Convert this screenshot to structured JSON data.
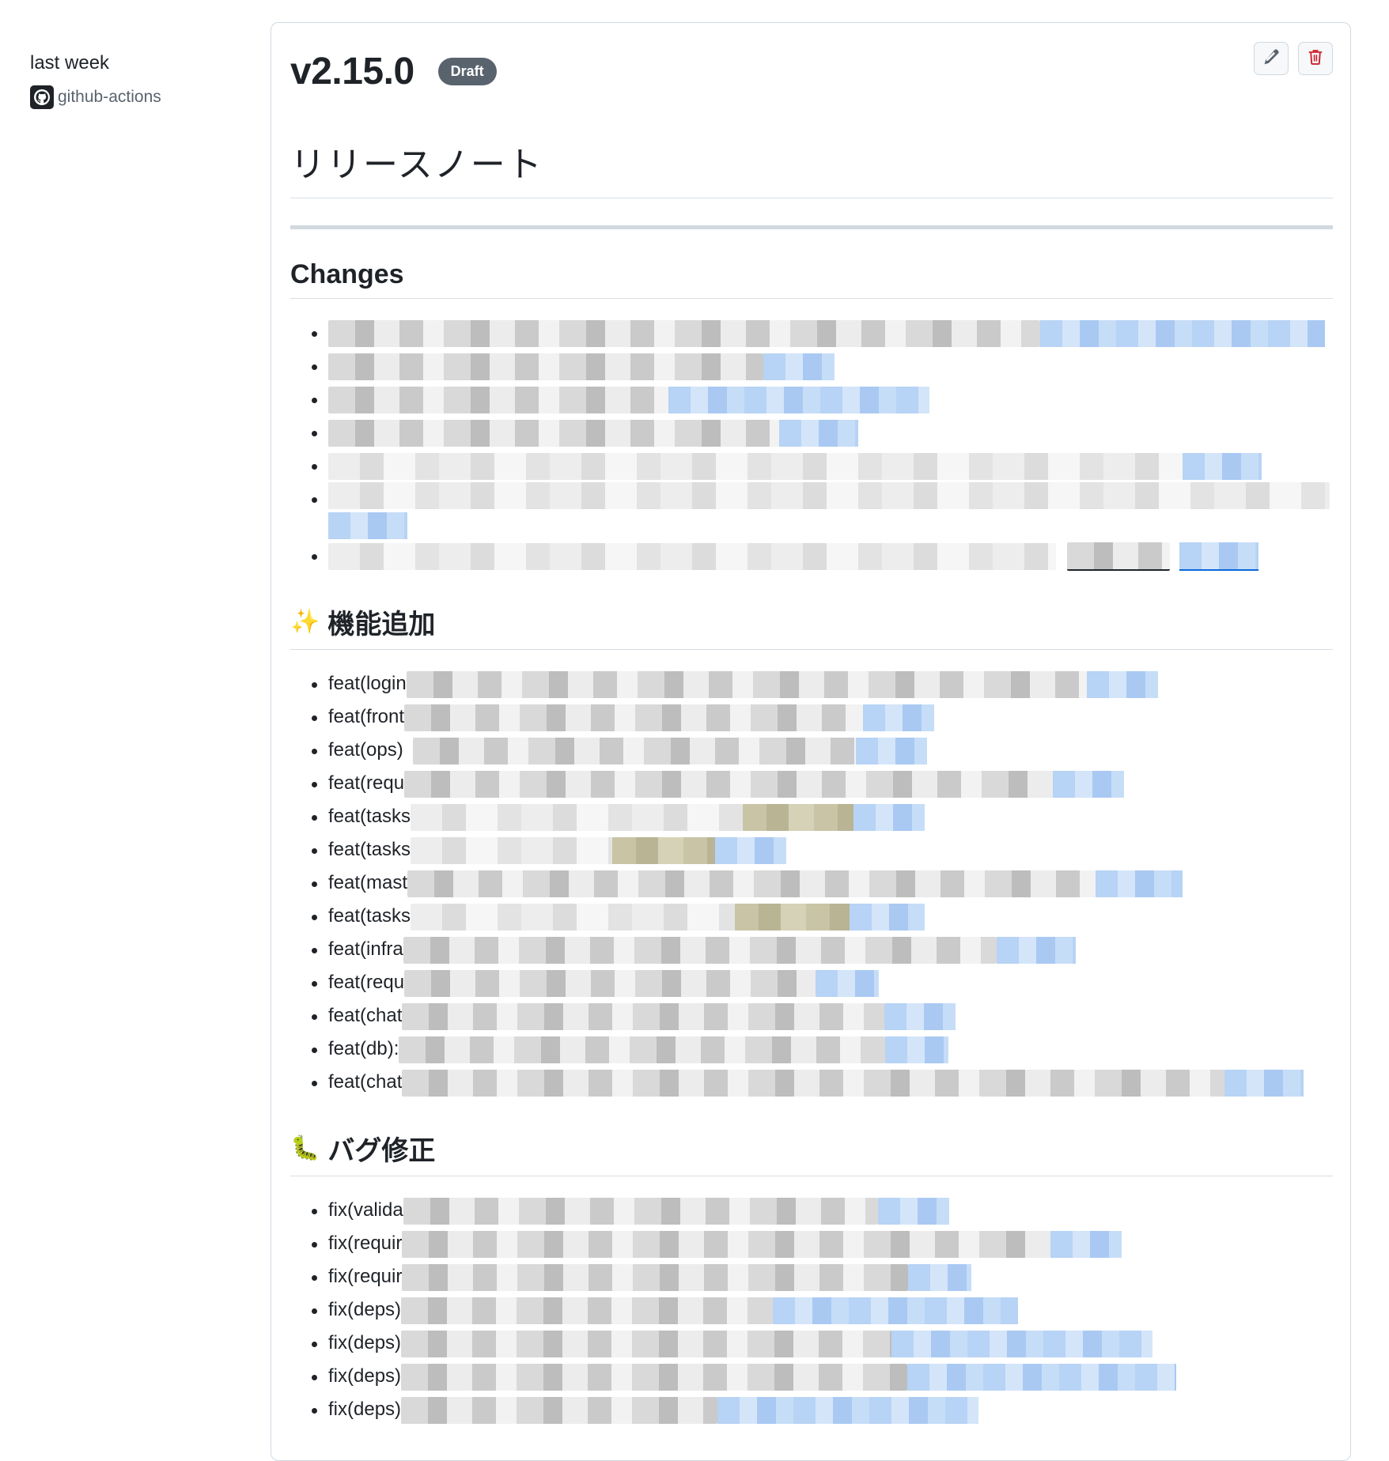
{
  "sidebar": {
    "time": "last week",
    "author": "github-actions"
  },
  "release": {
    "version": "v2.15.0",
    "badge": "Draft",
    "edit_label": "Edit",
    "delete_label": "Delete"
  },
  "body": {
    "h1": "リリースノート",
    "changes_heading": "Changes",
    "changes_count": 7,
    "features_emoji": "✨",
    "features_heading": "機能追加",
    "features": [
      "feat(login",
      "feat(front",
      "feat(ops)",
      "feat(requ",
      "feat(tasks",
      "feat(tasks",
      "feat(mast",
      "feat(tasks",
      "feat(infra",
      "feat(requ",
      "feat(chat",
      "feat(db):",
      "feat(chat"
    ],
    "bugs_emoji": "🐛",
    "bugs_heading": "バグ修正",
    "bugs": [
      "fix(valida",
      "fix(requir",
      "fix(requir",
      "fix(deps)",
      "fix(deps)",
      "fix(deps)",
      "fix(deps)"
    ]
  },
  "colors": {
    "accent": "#0969da",
    "badge_bg": "#59636e",
    "delete_red": "#cf222e"
  }
}
